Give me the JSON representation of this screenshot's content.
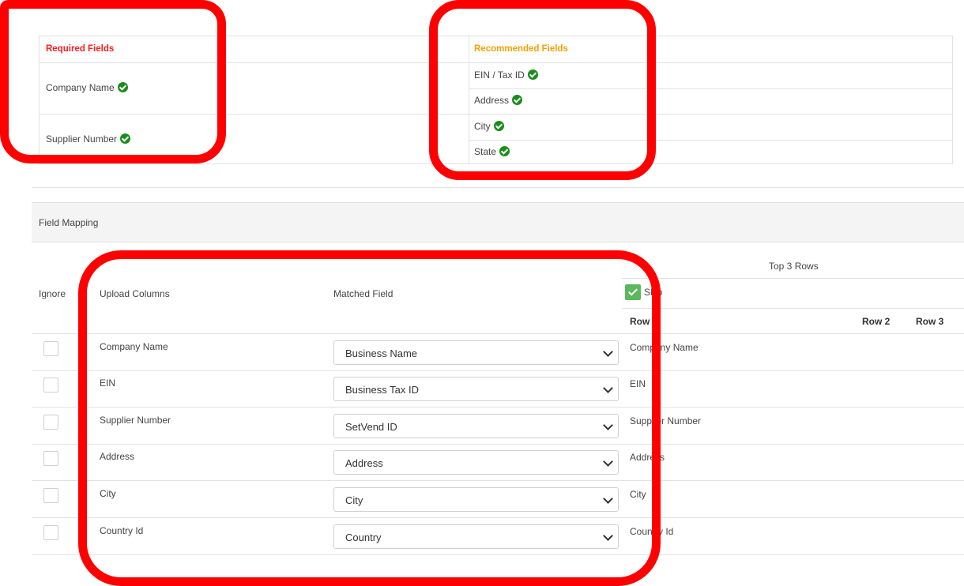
{
  "required": {
    "header": "Required Fields",
    "items": [
      "Company Name",
      "Supplier Number"
    ]
  },
  "recommended": {
    "header": "Recommended Fields",
    "items": [
      "EIN / Tax ID",
      "Address",
      "City",
      "State"
    ]
  },
  "field_mapping": {
    "title": "Field Mapping",
    "col_ignore": "Ignore",
    "col_upload": "Upload Columns",
    "col_matched": "Matched Field",
    "top_rows": "Top 3 Rows",
    "skip_label": "Skip",
    "row_headers": [
      "Row 1",
      "Row 2",
      "Row 3"
    ],
    "rows": [
      {
        "upload": "Company Name",
        "matched": "Business Name",
        "preview": "Company Name"
      },
      {
        "upload": "EIN",
        "matched": "Business Tax ID",
        "preview": "EIN"
      },
      {
        "upload": "Supplier Number",
        "matched": "SetVend ID",
        "preview": "Supplier Number"
      },
      {
        "upload": "Address",
        "matched": "Address",
        "preview": "Address"
      },
      {
        "upload": "City",
        "matched": "City",
        "preview": "City"
      },
      {
        "upload": "Country Id",
        "matched": "Country",
        "preview": "Country Id"
      }
    ]
  },
  "colors": {
    "required_header": "#ff1a1a",
    "recommended_header": "#f5a000",
    "check": "#1a8d1a",
    "skip_checkbox": "#5cb85c",
    "annotation": "#ff0000"
  },
  "icons": [
    "check-circle-icon",
    "chevron-down-icon",
    "checkbox-checked-icon"
  ]
}
